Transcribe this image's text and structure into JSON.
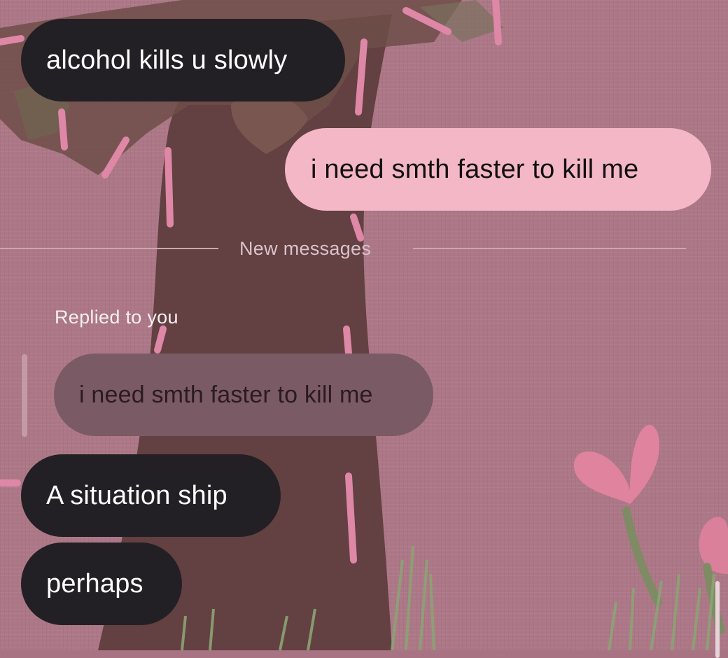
{
  "messages": {
    "msg1": "alcohol kills u slowly",
    "msg2": "i need smth faster to kill me",
    "divider": "New messages",
    "replied_label": "Replied to you",
    "quoted_reply": "i need smth faster to kill me",
    "msg3": "A situation ship",
    "msg4": "perhaps"
  },
  "colors": {
    "incoming_bubble": "#222024",
    "outgoing_bubble": "#f4b7c6",
    "quoted_bubble": "#7a5a64",
    "background": "#a87483"
  }
}
